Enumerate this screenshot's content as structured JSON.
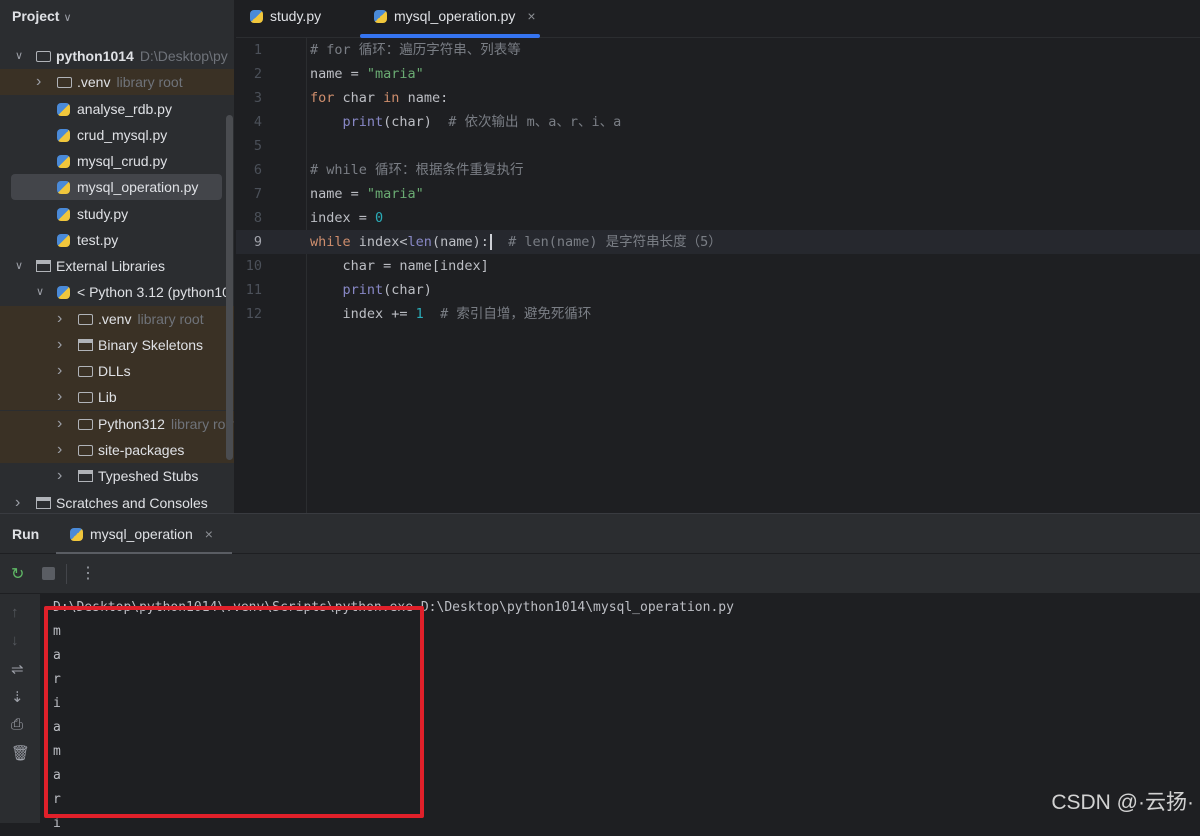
{
  "sidebar": {
    "title": "Project",
    "items": [
      {
        "label": "python1014",
        "hint": "D:\\Desktop\\py",
        "icon": "folder-icon",
        "depth": 0,
        "arrow": "v",
        "bold": true
      },
      {
        "label": ".venv",
        "hint": "library root",
        "icon": "folder-icon",
        "depth": 1,
        "arrow": ">",
        "lib": true
      },
      {
        "label": "analyse_rdb.py",
        "icon": "python-file-icon",
        "depth": 2
      },
      {
        "label": "crud_mysql.py",
        "icon": "python-file-icon",
        "depth": 2
      },
      {
        "label": "mysql_crud.py",
        "icon": "python-file-icon",
        "depth": 2
      },
      {
        "label": "mysql_operation.py",
        "icon": "python-file-icon",
        "depth": 2,
        "selected": true
      },
      {
        "label": "study.py",
        "icon": "python-file-icon",
        "depth": 2
      },
      {
        "label": "test.py",
        "icon": "python-file-icon",
        "depth": 2
      },
      {
        "label": "External Libraries",
        "icon": "library-icon",
        "depth": 0,
        "arrow": "v"
      },
      {
        "label": "< Python 3.12 (python10",
        "icon": "python-file-icon",
        "depth": 1,
        "arrow": "v"
      },
      {
        "label": ".venv",
        "hint": "library root",
        "icon": "folder-icon",
        "depth": 2,
        "arrow": ">",
        "lib": true
      },
      {
        "label": "Binary Skeletons",
        "icon": "library-icon",
        "depth": 2,
        "arrow": ">",
        "lib": true
      },
      {
        "label": "DLLs",
        "icon": "folder-icon",
        "depth": 2,
        "arrow": ">",
        "lib": true
      },
      {
        "label": "Lib",
        "icon": "folder-icon",
        "depth": 2,
        "arrow": ">",
        "lib": true
      },
      {
        "label": "Python312",
        "hint": "library root",
        "icon": "folder-icon",
        "depth": 2,
        "arrow": ">",
        "lib": true
      },
      {
        "label": "site-packages",
        "icon": "folder-icon",
        "depth": 2,
        "arrow": ">",
        "lib": true
      },
      {
        "label": "Typeshed Stubs",
        "icon": "library-icon",
        "depth": 2,
        "arrow": ">"
      },
      {
        "label": "Scratches and Consoles",
        "icon": "scratches-icon",
        "depth": 0,
        "arrow": ">"
      }
    ]
  },
  "editor": {
    "tabs": [
      {
        "label": "study.py"
      },
      {
        "label": "mysql_operation.py",
        "active": true,
        "close": "×"
      }
    ],
    "current_line": 9,
    "lines": [
      [
        [
          "cm",
          "# for 循环：遍历字符串、列表等"
        ]
      ],
      [
        [
          "",
          "name = "
        ],
        [
          "str",
          "\"maria\""
        ]
      ],
      [
        [
          "kw",
          "for"
        ],
        [
          "",
          " char "
        ],
        [
          "kw",
          "in"
        ],
        [
          "",
          " name:"
        ]
      ],
      [
        [
          "",
          "    "
        ],
        [
          "bi",
          "print"
        ],
        [
          "",
          "(char)  "
        ],
        [
          "cm",
          "# 依次输出 m、a、r、i、a"
        ]
      ],
      [],
      [
        [
          "cm",
          "# while 循环：根据条件重复执行"
        ]
      ],
      [
        [
          "",
          "name = "
        ],
        [
          "str",
          "\"maria\""
        ]
      ],
      [
        [
          "",
          "index = "
        ],
        [
          "num",
          "0"
        ]
      ],
      [
        [
          "kw",
          "while"
        ],
        [
          "",
          " index<"
        ],
        [
          "bi",
          "len"
        ],
        [
          "",
          "(name):"
        ],
        [
          "caret",
          ""
        ],
        [
          "",
          "  "
        ],
        [
          "cm",
          "# len(name) 是字符串长度（5）"
        ]
      ],
      [
        [
          "",
          "    char = name[index]"
        ]
      ],
      [
        [
          "",
          "    "
        ],
        [
          "bi",
          "print"
        ],
        [
          "",
          "(char)"
        ]
      ],
      [
        [
          "",
          "    index += "
        ],
        [
          "num",
          "1"
        ],
        [
          "",
          "  "
        ],
        [
          "cm",
          "# 索引自增，避免死循环"
        ]
      ]
    ]
  },
  "run": {
    "title": "Run",
    "tab": "mysql_operation",
    "close": "×",
    "output": [
      "D:\\Desktop\\python1014\\.venv\\Scripts\\python.exe D:\\Desktop\\python1014\\mysql_operation.py",
      "m",
      "a",
      "r",
      "i",
      "a",
      "m",
      "a",
      "r",
      "i"
    ]
  },
  "watermark": "CSDN @·云扬·",
  "colors": {
    "accent": "#3574f0",
    "highlight_box": "#e0202a"
  }
}
